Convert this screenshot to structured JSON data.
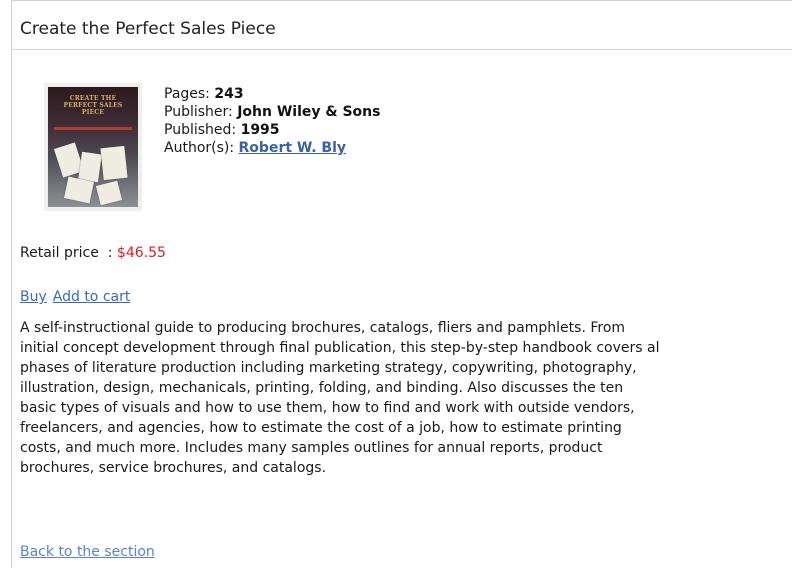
{
  "page": {
    "title": "Create the Perfect Sales Piece"
  },
  "book": {
    "cover_title_text": "CREATE THE PERFECT SALES PIECE",
    "pages_label": "Pages: ",
    "pages_value": "243",
    "publisher_label": "Publisher: ",
    "publisher_value": "John Wiley & Sons",
    "published_label": "Published: ",
    "published_value": "1995",
    "authors_label": "Author(s): ",
    "author_name": "Robert W. Bly"
  },
  "price": {
    "label": "Retail price  : ",
    "value": "$46.55"
  },
  "actions": {
    "buy_label": "Buy",
    "add_to_cart_label": "Add to cart"
  },
  "description": {
    "lines": [
      "A self-instructional guide to producing brochures, catalogs, fliers and pamphlets. From",
      "initial concept development through final publication, this step-by-step handbook covers al",
      "phases of literature production including marketing strategy, copywriting, photography,",
      "illustration, design, mechanicals, printing, folding, and binding. Also discusses the ten",
      "basic types of visuals and how to use them, how to find and work with outside vendors,",
      "freelancers, and agencies, how to estimate the cost of a job, how to estimate printing",
      "costs, and much more. Includes many samples outlines for annual reports, product",
      "brochures, service brochures, and catalogs."
    ]
  },
  "footer": {
    "back_label": "Back to the section"
  },
  "colors": {
    "price": "#e31a1a",
    "link": "#3b6ab5",
    "author_link": "#3b5fa8",
    "border": "#d4d4d4"
  }
}
